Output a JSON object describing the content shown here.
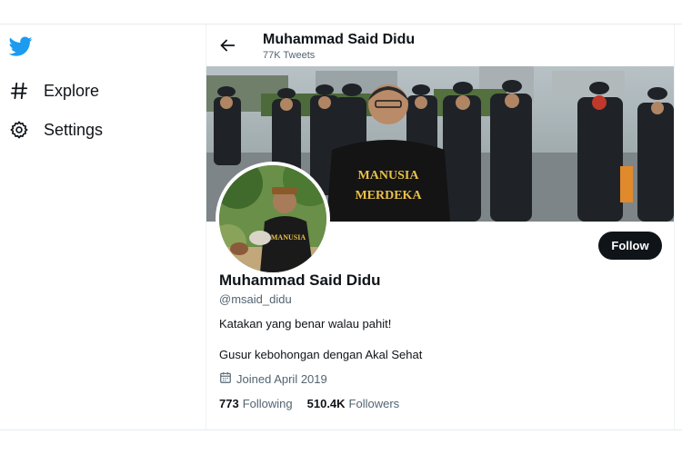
{
  "nav": {
    "items": [
      {
        "icon": "hashtag-icon",
        "label": "Explore"
      },
      {
        "icon": "gear-icon",
        "label": "Settings"
      }
    ]
  },
  "header": {
    "name": "Muhammad Said Didu",
    "tweet_count": "77K Tweets"
  },
  "banner": {
    "shirt_line1": "MANUSIA",
    "shirt_line2": "MERDEKA"
  },
  "avatar": {
    "shirt_text": "MANUSIA"
  },
  "profile": {
    "name": "Muhammad Said Didu",
    "handle": "@msaid_didu",
    "bio_line1": "Katakan yang benar walau pahit!",
    "bio_line2": "Gusur kebohongan dengan Akal Sehat",
    "joined": "Joined April 2019",
    "following_count": "773",
    "following_label": "Following",
    "followers_count": "510.4K",
    "followers_label": "Followers",
    "follow_button": "Follow"
  },
  "colors": {
    "twitter_blue": "#1d9bf0",
    "text_primary": "#0f1419",
    "text_secondary": "#536471",
    "button_bg": "#0f1419"
  }
}
